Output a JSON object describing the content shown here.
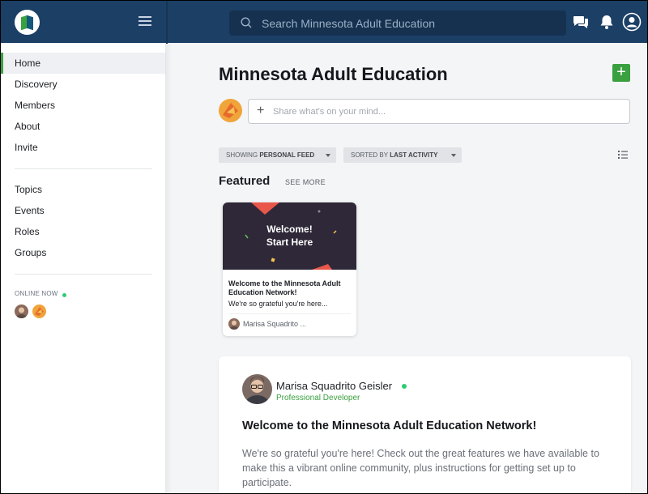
{
  "colors": {
    "topbar": "#1c3f66",
    "accent": "#3aa040",
    "online": "#2ecc71"
  },
  "header": {
    "logo_icon": "network-logo-icon",
    "menu_icon": "hamburger-icon",
    "search_placeholder": "Search Minnesota Adult Education",
    "icons": [
      "messages-icon",
      "bell-icon",
      "user-account-icon"
    ]
  },
  "sidebar": {
    "items_primary": [
      {
        "label": "Home",
        "active": true
      },
      {
        "label": "Discovery"
      },
      {
        "label": "Members"
      },
      {
        "label": "About"
      },
      {
        "label": "Invite"
      }
    ],
    "items_secondary": [
      {
        "label": "Topics"
      },
      {
        "label": "Events"
      },
      {
        "label": "Roles"
      },
      {
        "label": "Groups"
      }
    ],
    "online_label": "ONLINE NOW"
  },
  "main": {
    "title": "Minnesota Adult Education",
    "add_label": "+",
    "composer_placeholder": "Share what's on your mind...",
    "filters": {
      "feed_prefix": "SHOWING",
      "feed_value": "PERSONAL FEED",
      "sort_prefix": "SORTED BY",
      "sort_value": "LAST ACTIVITY"
    },
    "featured": {
      "heading": "Featured",
      "see_more": "SEE MORE",
      "card": {
        "image_line1": "Welcome!",
        "image_line2": "Start Here",
        "title": "Welcome to the Minnesota Adult Education Network!",
        "excerpt": "We're so grateful you're here...",
        "author": "Marisa Squadrito ..."
      }
    },
    "post": {
      "author": "Marisa Squadrito Geisler",
      "role": "Professional Developer",
      "title": "Welcome to the Minnesota Adult Education Network!",
      "body": "We're so grateful you're here! Check out the great features we have available to make this a vibrant online community, plus instructions for getting set up to participate."
    }
  }
}
